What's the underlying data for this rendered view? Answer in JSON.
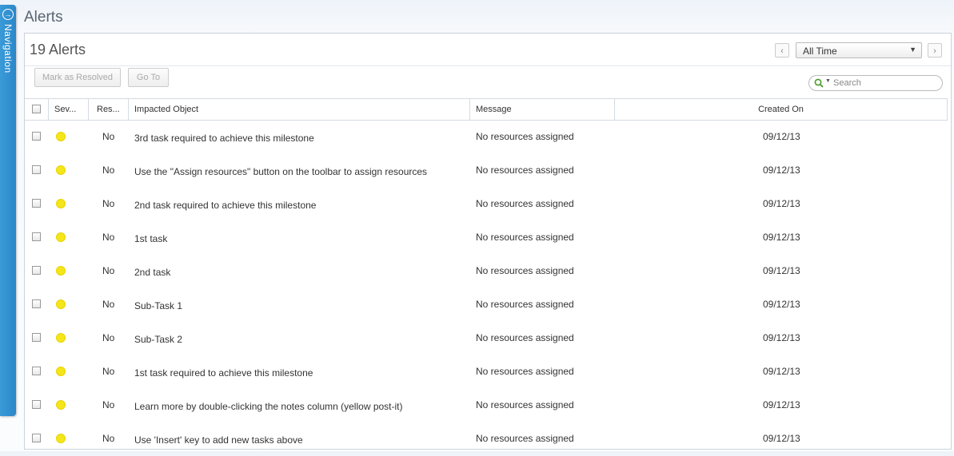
{
  "navigation": {
    "label": "Navigation"
  },
  "page": {
    "title": "Alerts"
  },
  "alerts_panel": {
    "count_title": "19 Alerts",
    "time_filter": {
      "selected": "All Time"
    },
    "toolbar": {
      "mark_resolved_label": "Mark as Resolved",
      "go_to_label": "Go To"
    },
    "search": {
      "placeholder": "Search"
    }
  },
  "table": {
    "columns": {
      "severity": "Sev...",
      "resolved": "Res...",
      "impacted_object": "Impacted Object",
      "message": "Message",
      "created_on": "Created On"
    },
    "severity_color": "#f5e51b",
    "rows": [
      {
        "resolved": "No",
        "impacted_object": "3rd task required to achieve this milestone",
        "message": "No resources assigned",
        "created_on": "09/12/13"
      },
      {
        "resolved": "No",
        "impacted_object": "Use the \"Assign resources\" button on the toolbar to assign resources",
        "message": "No resources assigned",
        "created_on": "09/12/13"
      },
      {
        "resolved": "No",
        "impacted_object": "2nd task required to achieve this milestone",
        "message": "No resources assigned",
        "created_on": "09/12/13"
      },
      {
        "resolved": "No",
        "impacted_object": "1st task",
        "message": "No resources assigned",
        "created_on": "09/12/13"
      },
      {
        "resolved": "No",
        "impacted_object": "2nd task",
        "message": "No resources assigned",
        "created_on": "09/12/13"
      },
      {
        "resolved": "No",
        "impacted_object": "Sub-Task 1",
        "message": "No resources assigned",
        "created_on": "09/12/13"
      },
      {
        "resolved": "No",
        "impacted_object": "Sub-Task 2",
        "message": "No resources assigned",
        "created_on": "09/12/13"
      },
      {
        "resolved": "No",
        "impacted_object": "1st task required to achieve this milestone",
        "message": "No resources assigned",
        "created_on": "09/12/13"
      },
      {
        "resolved": "No",
        "impacted_object": "Learn more by double-clicking the notes column (yellow post-it)",
        "message": "No resources assigned",
        "created_on": "09/12/13"
      },
      {
        "resolved": "No",
        "impacted_object": "Use 'Insert' key to add new tasks above",
        "message": "No resources assigned",
        "created_on": "09/12/13"
      }
    ]
  }
}
